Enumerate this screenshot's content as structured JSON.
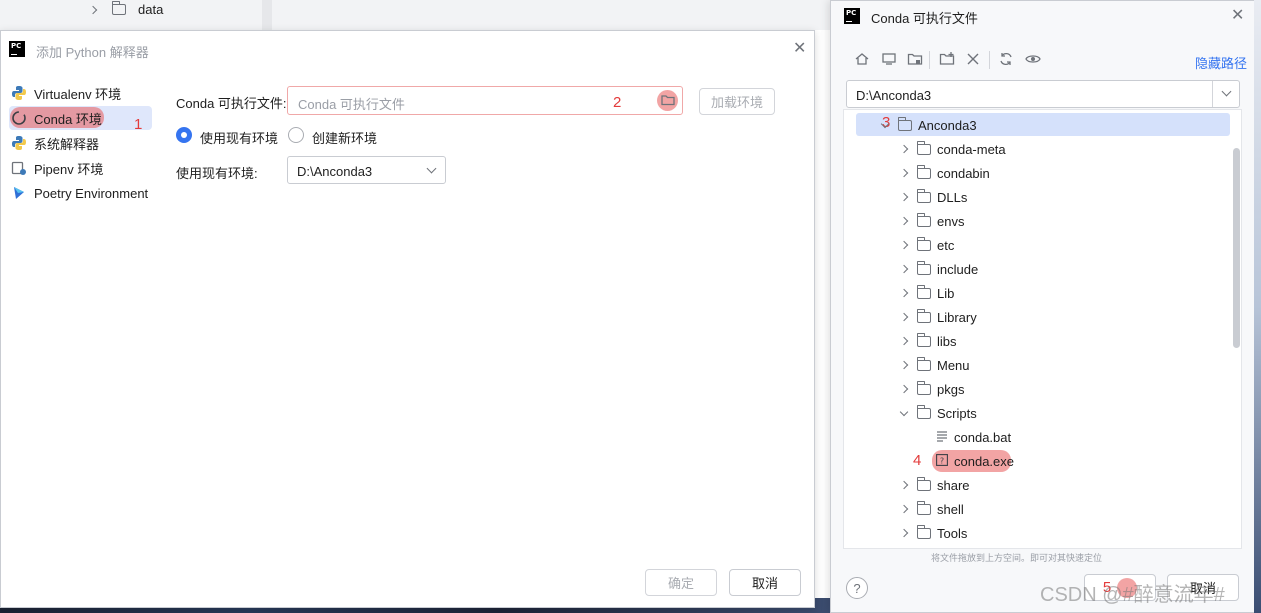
{
  "background": {
    "tree_item": "data"
  },
  "left_dialog": {
    "title": "添加 Python 解释器",
    "sidebar": [
      {
        "label": "Virtualenv 环境",
        "icon": "python-icon"
      },
      {
        "label": "Conda 环境",
        "icon": "conda-icon"
      },
      {
        "label": "系统解释器",
        "icon": "python-icon"
      },
      {
        "label": "Pipenv 环境",
        "icon": "pipenv-icon"
      },
      {
        "label": "Poetry Environment",
        "icon": "poetry-icon"
      }
    ],
    "conda_exec_label": "Conda 可执行文件:",
    "conda_exec_placeholder": "Conda 可执行文件",
    "load_env_button": "加载环境",
    "radio_existing": "使用现有环境",
    "radio_new": "创建新环境",
    "existing_env_label": "使用现有环境:",
    "existing_env_value": "D:\\Anconda3",
    "ok_button": "确定",
    "cancel_button": "取消"
  },
  "right_dialog": {
    "title": "Conda 可执行文件",
    "hide_path": "隐藏路径",
    "path_value": "D:\\Anconda3",
    "tree": {
      "root": "Anconda3",
      "children": [
        "conda-meta",
        "condabin",
        "DLLs",
        "envs",
        "etc",
        "include",
        "Lib",
        "Library",
        "libs",
        "Menu",
        "pkgs",
        "Scripts"
      ],
      "scripts_children": [
        "conda.bat",
        "conda.exe"
      ],
      "after": [
        "share",
        "shell",
        "Tools"
      ]
    },
    "hint": "将文件拖放到上方空间。即可对其快速定位",
    "help": "?",
    "cancel_button": "取消"
  },
  "annotations": [
    "1",
    "2",
    "3",
    "4",
    "5"
  ],
  "watermark": "CSDN @#醉意流年#",
  "colors": {
    "accent": "#3574f0",
    "annotation": "#e33b3b",
    "selection": "#d5e1fb"
  }
}
